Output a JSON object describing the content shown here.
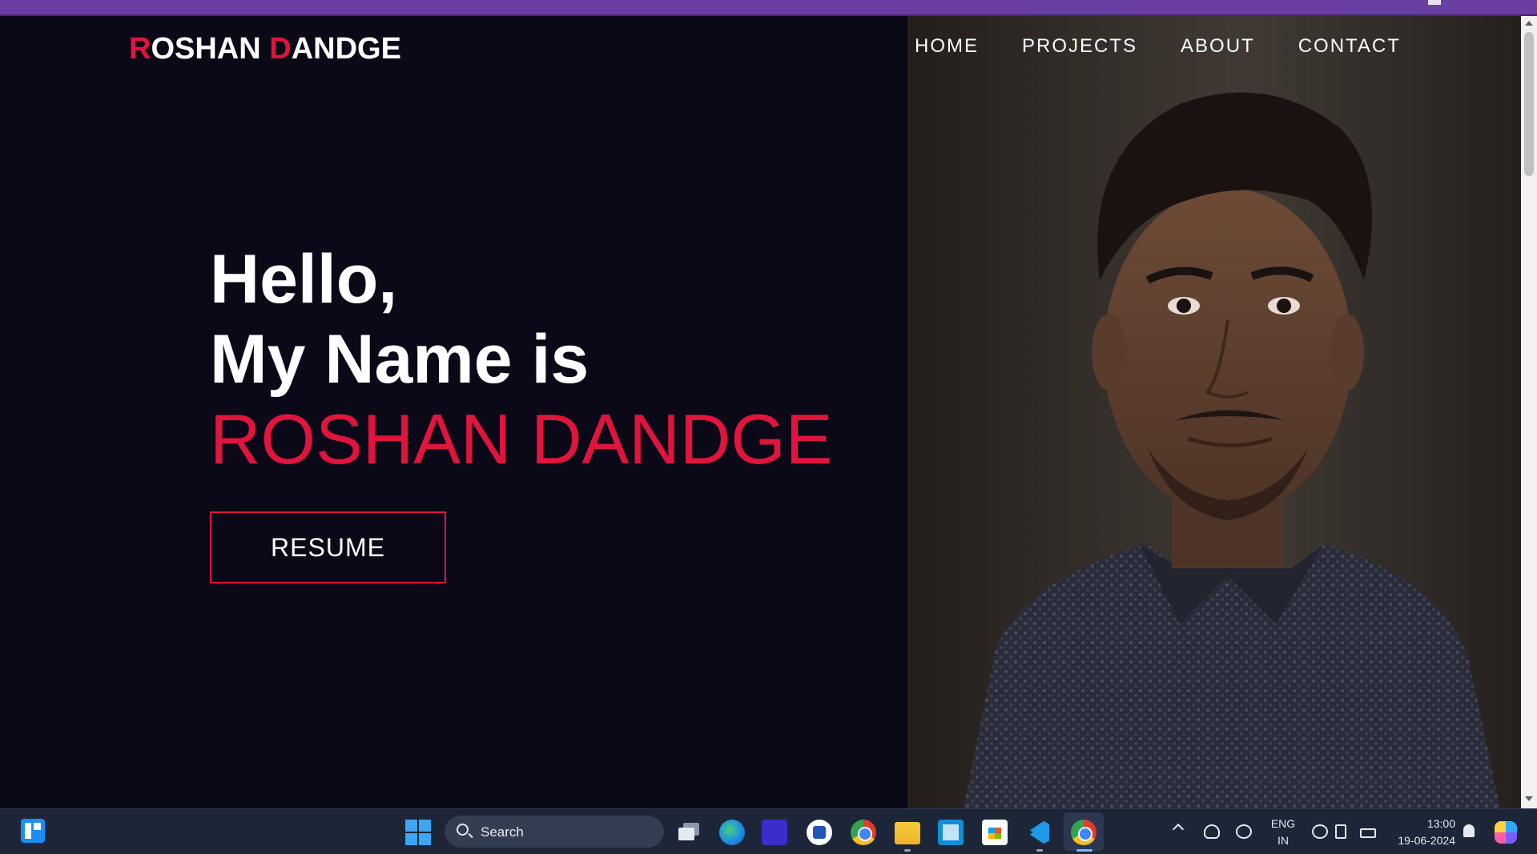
{
  "browser": {
    "accent_color": "#6a3fa4"
  },
  "site": {
    "logo": {
      "first_initial": "R",
      "first_rest": "OSHAN ",
      "last_initial": "D",
      "last_rest": "ANDGE"
    },
    "nav": [
      "HOME",
      "PROJECTS",
      "ABOUT",
      "CONTACT"
    ],
    "hero": {
      "line1": "Hello,",
      "line2": "My Name is",
      "name": "ROSHAN DANDGE",
      "button": "RESUME"
    },
    "colors": {
      "background": "#0b0917",
      "accent": "#e0143d",
      "text": "#ffffff"
    },
    "photo": "portrait-photo"
  },
  "taskbar": {
    "search_placeholder": "Search",
    "pinned": [
      "widgets-icon",
      "start-icon",
      "task-view-icon",
      "edge-icon",
      "vector-app-icon",
      "word-icon",
      "chrome-icon",
      "file-explorer-icon",
      "sticky-notes-icon",
      "store-icon",
      "vscode-icon",
      "chrome-active-icon"
    ],
    "tray": {
      "lang_line1": "ENG",
      "lang_line2": "IN",
      "time": "13:00",
      "date": "19-06-2024"
    }
  }
}
